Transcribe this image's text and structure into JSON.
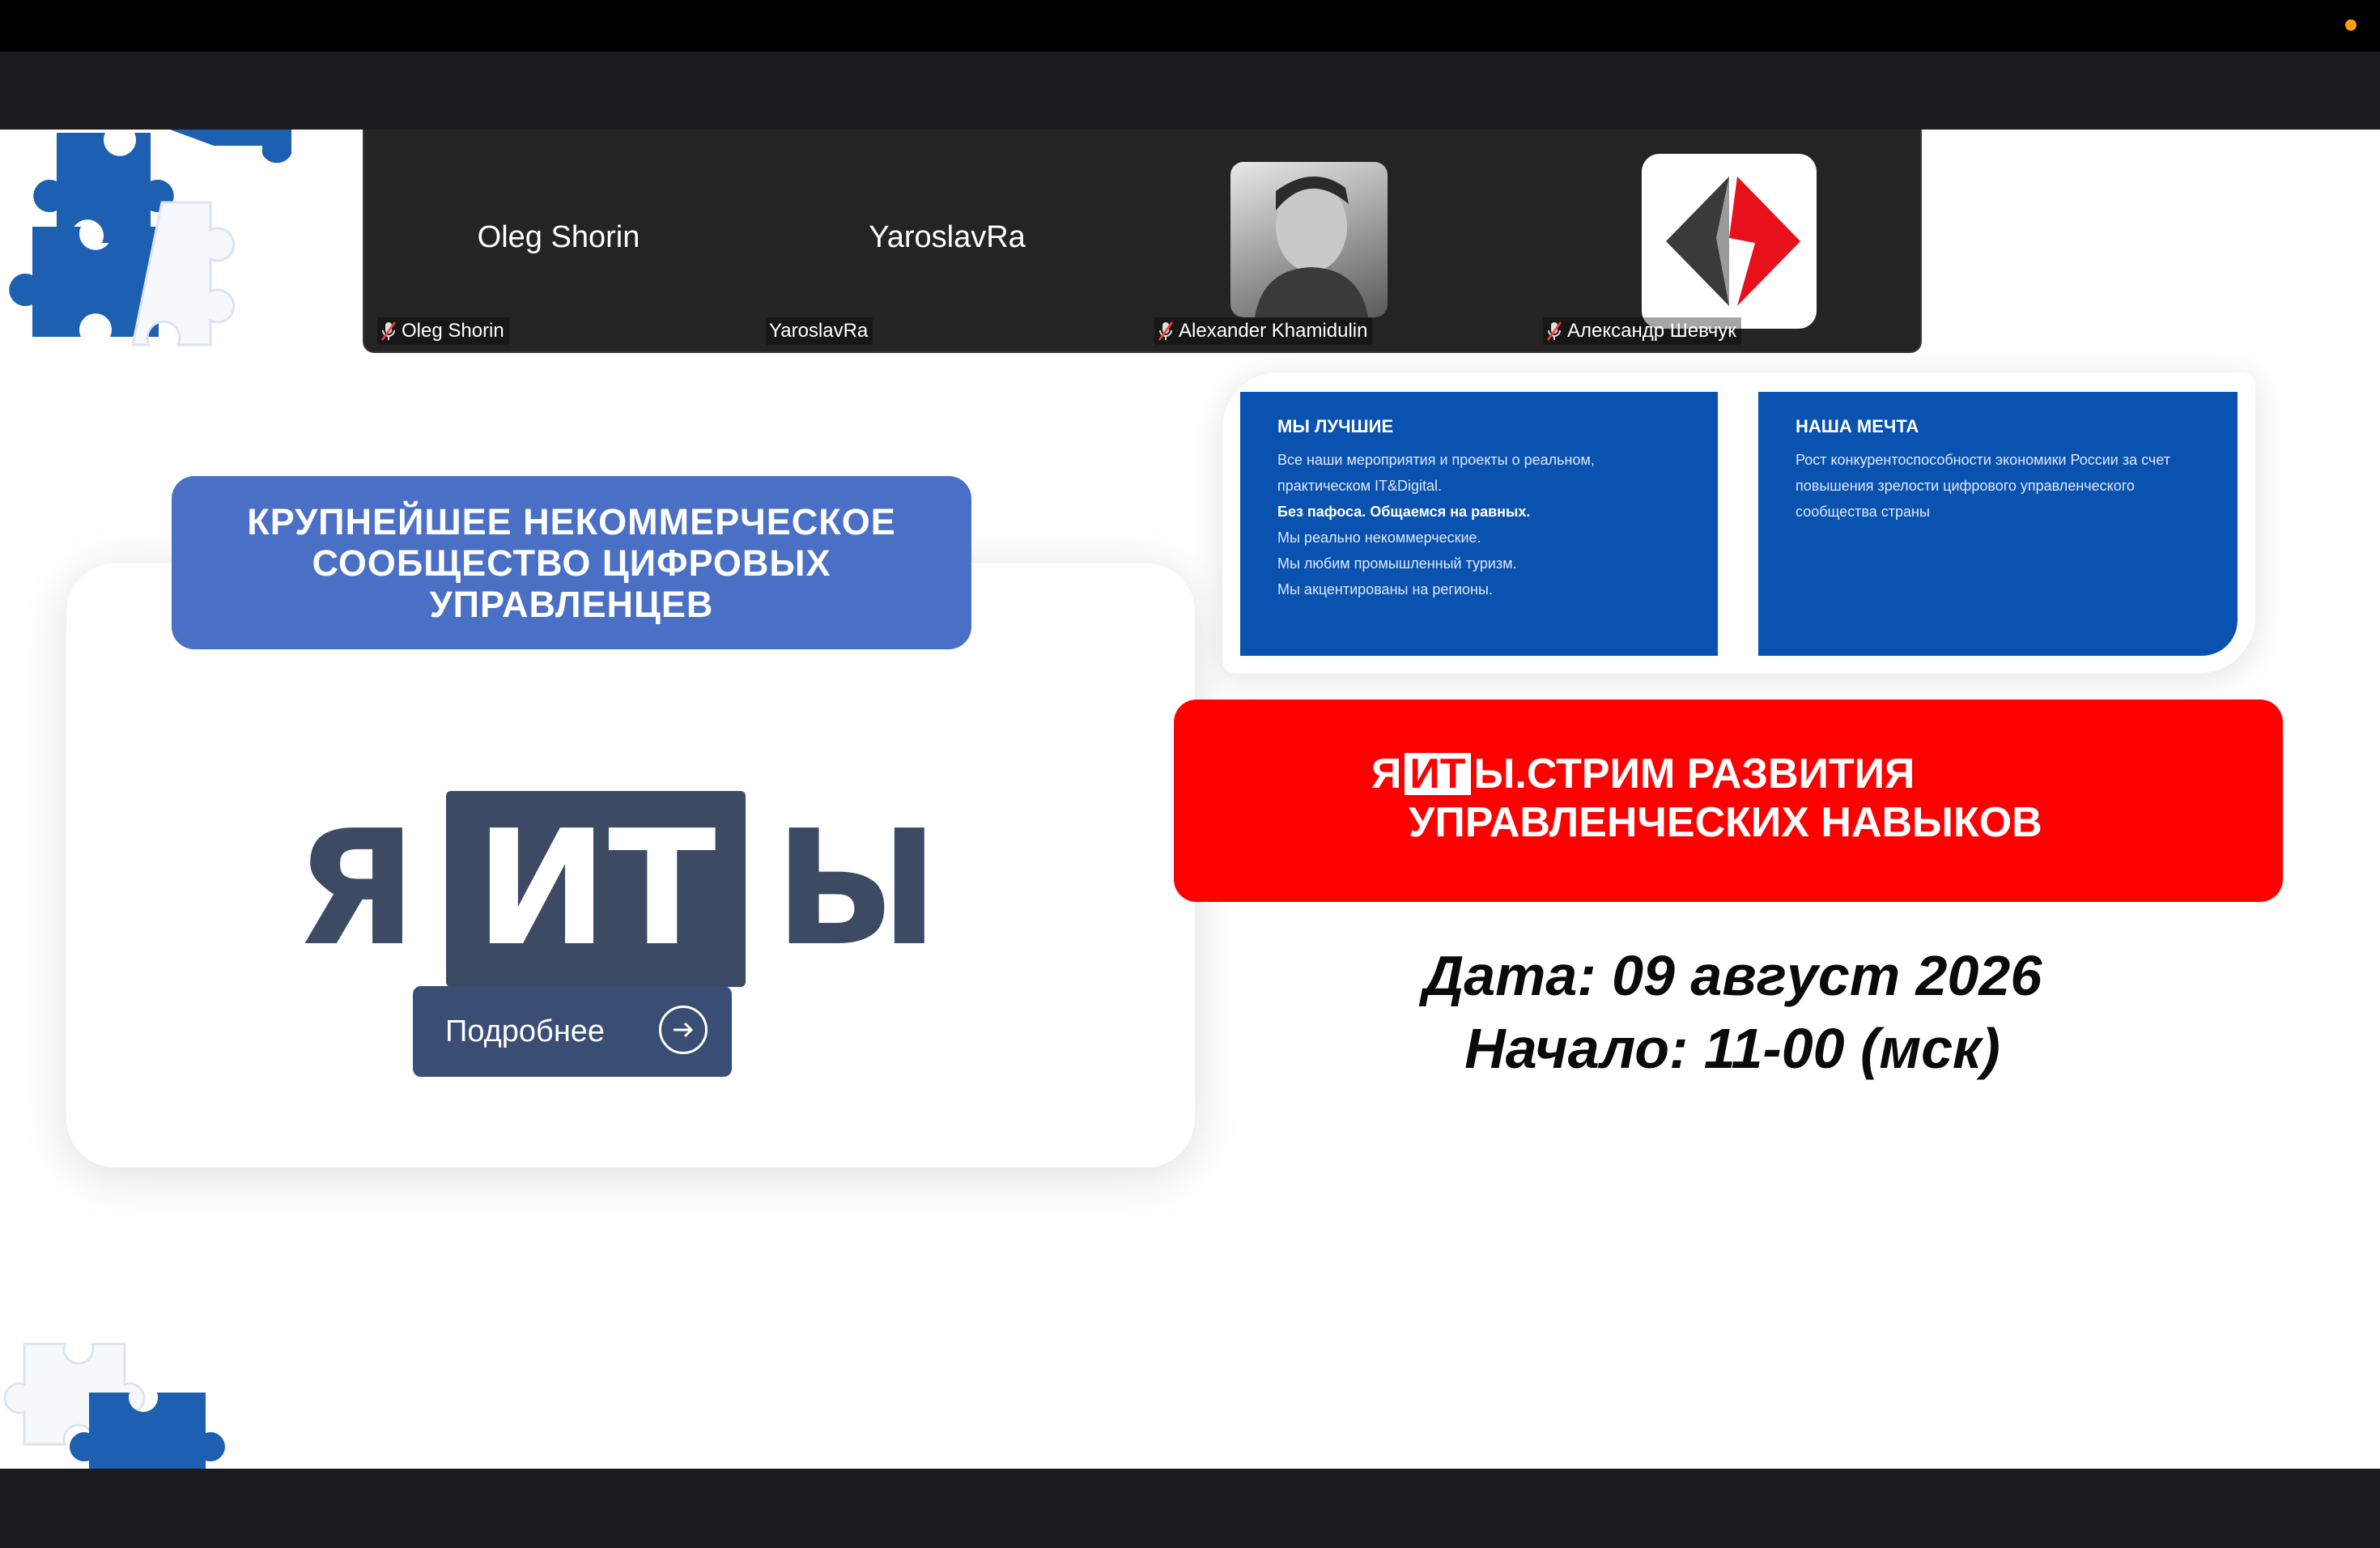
{
  "participants": [
    {
      "display_name": "Oleg Shorin",
      "label": "Oleg Shorin",
      "muted": true,
      "video": "name"
    },
    {
      "display_name": "YaroslavRa",
      "label": "YaroslavRa",
      "muted": false,
      "video": "name"
    },
    {
      "display_name": "",
      "label": "Alexander Khamidulin",
      "muted": true,
      "video": "photo"
    },
    {
      "display_name": "",
      "label": "Александр Шевчук",
      "muted": true,
      "video": "logo"
    }
  ],
  "slide": {
    "badge_line1": "КРУПНЕЙШЕЕ НЕКОММЕРЧЕСКОЕ",
    "badge_line2": "СООБЩЕСТВО ЦИФРОВЫХ",
    "badge_line3": "УПРАВЛЕНЦЕВ",
    "logo_ya": "Я",
    "logo_it": "ИТ",
    "logo_y": "Ы",
    "more_button": "Подробнее",
    "box1": {
      "heading": "МЫ ЛУЧШИЕ",
      "line1": "Все наши мероприятия и проекты о реальном,",
      "line2": "практическом IT&Digital.",
      "line3": "Без пафоса. Общаемся на равных.",
      "line4": "Мы реально некоммерческие.",
      "line5": "Мы любим промышленный туризм.",
      "line6": "Мы акцентированы на регионы."
    },
    "box2": {
      "heading": "НАША МЕЧТА",
      "line1": "Рост конкурентоспособности экономики России за счет",
      "line2": "повышения зрелости цифрового управленческого",
      "line3": "сообщества страны"
    },
    "banner_ya": "Я",
    "banner_it": "ИТ",
    "banner_rest": "Ы.СТРИМ РАЗВИТИЯ",
    "banner_line2": "УПРАВЛЕНЧЕСКИХ НАВЫКОВ",
    "date_line": "Дата: 09 август 2026",
    "start_line": "Начало: 11-00 (мск)"
  },
  "colors": {
    "accent_blue": "#4a70c6",
    "box_blue": "#0a52b0",
    "banner_red": "#ff0000",
    "logo_slate": "#3c4a63",
    "puzzle_blue": "#1d5fb1",
    "recording_dot": "#ff9f0a"
  },
  "icons": [
    "muted-mic-icon",
    "arrow-right-icon",
    "puzzle-piece-icon",
    "recording-indicator-icon"
  ]
}
